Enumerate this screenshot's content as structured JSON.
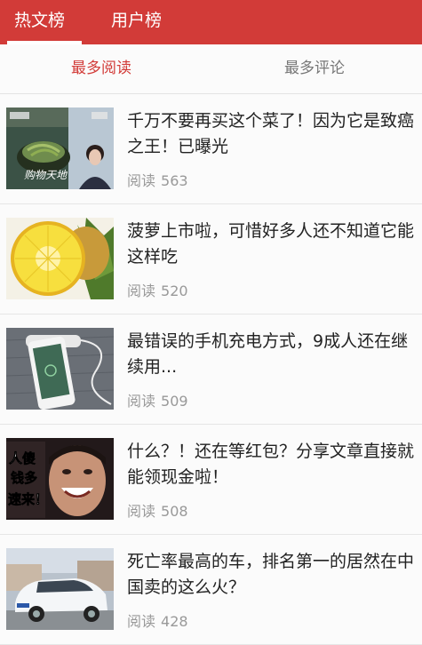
{
  "header": {
    "tabs": [
      {
        "label": "热文榜",
        "active": true
      },
      {
        "label": "用户榜",
        "active": false
      }
    ],
    "accent_color": "#d23b38"
  },
  "subtabs": [
    {
      "label": "最多阅读",
      "active": true
    },
    {
      "label": "最多评论",
      "active": false
    }
  ],
  "articles": [
    {
      "title": "千万不要再买这个菜了！因为它是致癌之王！已曝光",
      "read_label": "阅读",
      "reads": "563",
      "thumb_text": "购物天地"
    },
    {
      "title": "菠萝上市啦，可惜好多人还不知道它能这样吃",
      "read_label": "阅读",
      "reads": "520"
    },
    {
      "title": "最错误的手机充电方式，9成人还在继续用...",
      "read_label": "阅读",
      "reads": "509"
    },
    {
      "title": "什么？！还在等红包？分享文章直接就能领现金啦！",
      "read_label": "阅读",
      "reads": "508",
      "thumb_text": [
        "人傻",
        "钱多",
        "速来！"
      ]
    },
    {
      "title": "死亡率最高的车，排名第一的居然在中国卖的这么火？",
      "read_label": "阅读",
      "reads": "428"
    }
  ]
}
